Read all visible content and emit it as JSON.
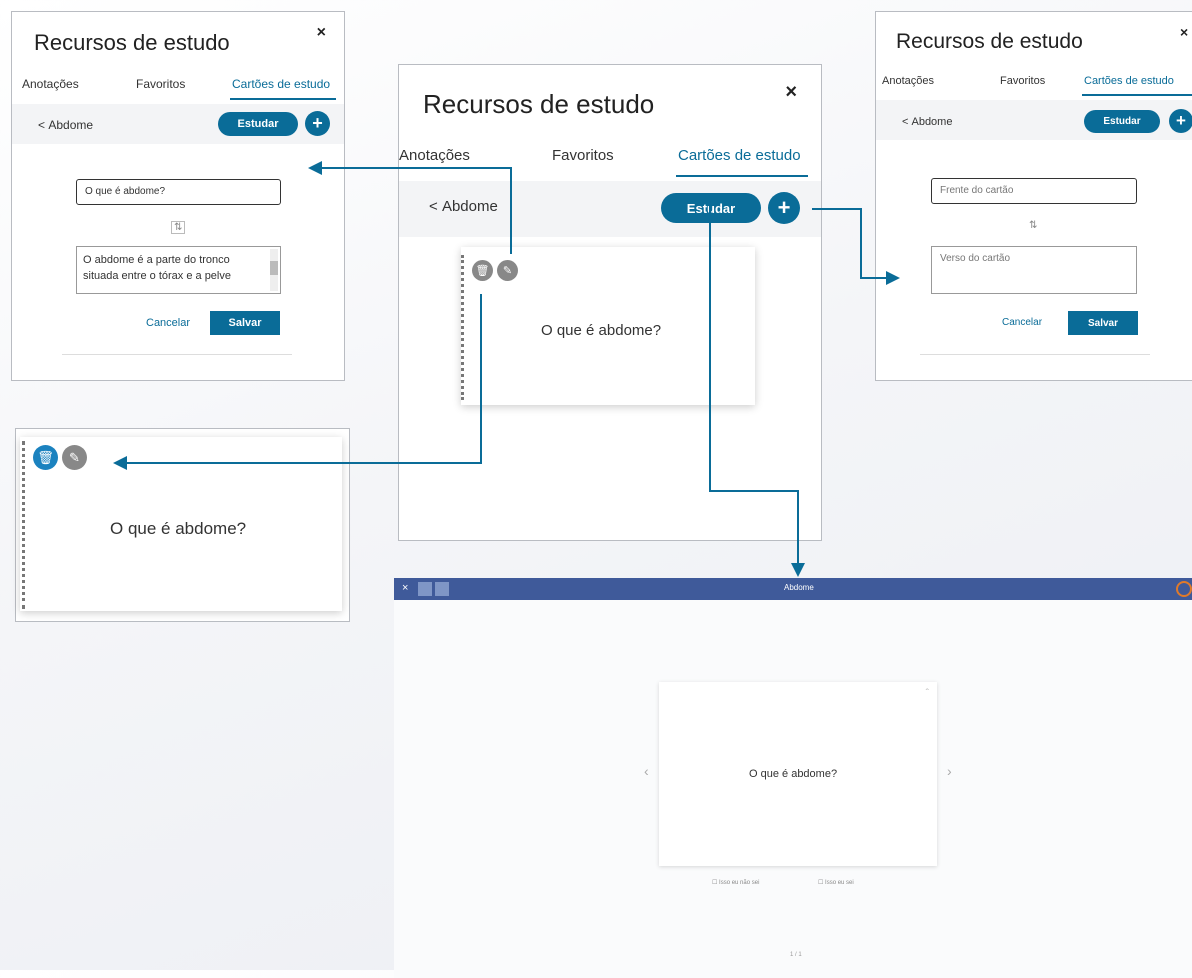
{
  "app": {
    "title": "Recursos de estudo",
    "close": "×",
    "tabs": [
      "Anotações",
      "Favoritos",
      "Cartões de estudo"
    ],
    "back_label": "Abdome",
    "study_button": "Estudar",
    "add_button": "+"
  },
  "card": {
    "question": "O que é abdome?"
  },
  "edit_form": {
    "front_value": "O que é abdome?",
    "back_value": "O abdome é a parte do tronco situada entre o tórax e a pelve",
    "flip_icon": "⇅",
    "cancel": "Cancelar",
    "save": "Salvar"
  },
  "new_form": {
    "front_placeholder": "Frente do cartão",
    "back_placeholder": "Verso do cartão",
    "flip_icon": "⇅",
    "cancel": "Cancelar",
    "save": "Salvar"
  },
  "study_view": {
    "header_title": "Abdome",
    "question": "O que é abdome?",
    "prev": "‹",
    "next": "›",
    "dont_know": "Isso eu não sei",
    "know": "Isso eu sei",
    "counter": "1 / 1"
  },
  "colors": {
    "accent": "#0a6c98",
    "study_header": "#3f5a9a",
    "trash_active": "#1b82bf",
    "icon_gray": "#888888"
  }
}
